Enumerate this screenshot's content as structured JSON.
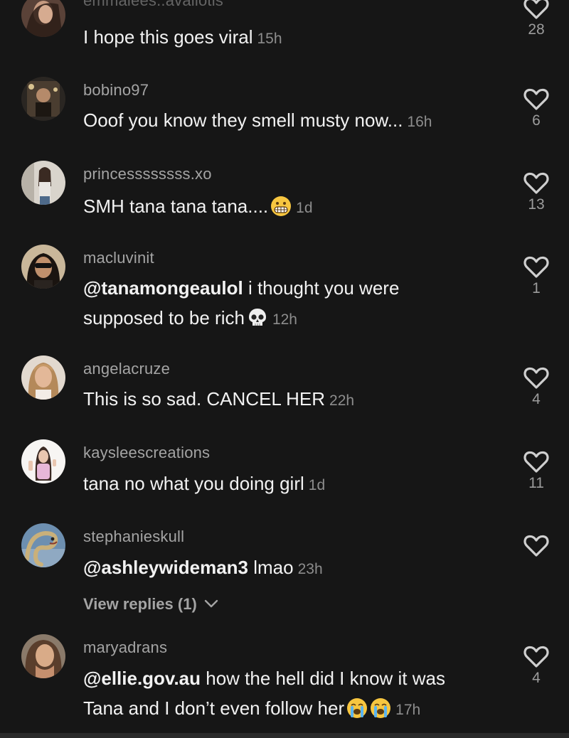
{
  "comments": [
    {
      "username": "emmalees..avaliotis",
      "segments": [
        {
          "text": "I hope this goes viral",
          "mention": false
        }
      ],
      "emojis": [],
      "time": "15h",
      "likes": "28"
    },
    {
      "username": "bobino97",
      "segments": [
        {
          "text": "Ooof you know they smell musty now...",
          "mention": false
        }
      ],
      "emojis": [],
      "time": "16h",
      "likes": "6"
    },
    {
      "username": "princessssssss.xo",
      "segments": [
        {
          "text": "SMH tana tana tana....",
          "mention": false
        }
      ],
      "emojis": [
        "grimace"
      ],
      "time": "1d",
      "likes": "13"
    },
    {
      "username": "macluvinit",
      "segments": [
        {
          "text": "@tanamongeaulol",
          "mention": true
        },
        {
          "text": " i thought you were supposed to be rich",
          "mention": false
        }
      ],
      "emojis": [
        "skull"
      ],
      "time": "12h",
      "likes": "1"
    },
    {
      "username": "angelacruze",
      "segments": [
        {
          "text": "This is so sad. CANCEL HER",
          "mention": false
        }
      ],
      "emojis": [],
      "time": "22h",
      "likes": "4"
    },
    {
      "username": "kaysleescreations",
      "segments": [
        {
          "text": "tana no what you doing girl",
          "mention": false
        }
      ],
      "emojis": [],
      "time": "1d",
      "likes": "11"
    },
    {
      "username": "stephanieskull",
      "segments": [
        {
          "text": "@ashleywideman3",
          "mention": true
        },
        {
          "text": " lmao",
          "mention": false
        }
      ],
      "emojis": [],
      "time": "23h",
      "likes": ""
    },
    {
      "username": "maryadrans",
      "segments": [
        {
          "text": "@ellie.gov.au",
          "mention": true
        },
        {
          "text": " how the hell did I know it was Tana and I don’t even follow her",
          "mention": false
        }
      ],
      "emojis": [
        "sob",
        "sob"
      ],
      "time": "17h",
      "likes": "4"
    }
  ],
  "view_replies": {
    "label": "View replies (1)",
    "chevron_icon": "chevron-down-icon"
  },
  "icons": {
    "like": "heart-outline-icon",
    "avatar": "user-avatar"
  },
  "colors": {
    "background": "#161616",
    "username": "#a4a4a4",
    "text": "#f2f2f2",
    "meta": "#8d8d8d",
    "heart": "#cfcfcf"
  }
}
